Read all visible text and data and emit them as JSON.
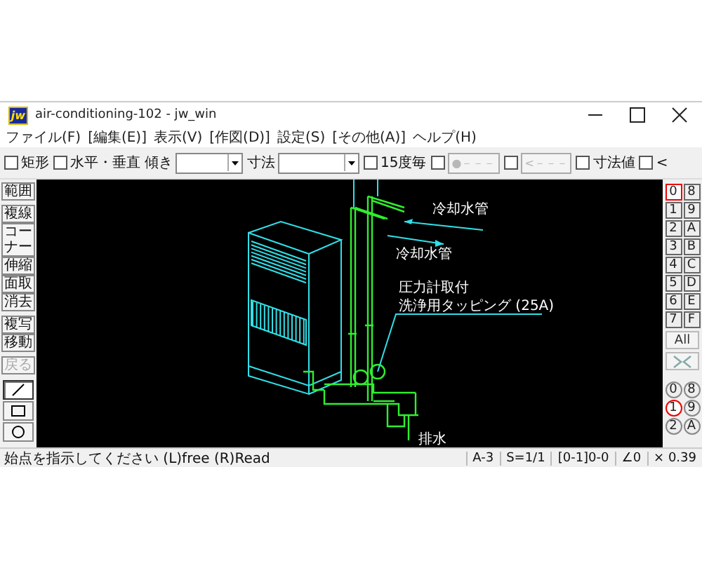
{
  "window": {
    "app_icon": "jw",
    "title": "air-conditioning-102 - jw_win"
  },
  "menu": [
    "ファイル(F)",
    "[編集(E)]",
    "表示(V)",
    "[作図(D)]",
    "設定(S)",
    "[その他(A)]",
    "ヘルプ(H)"
  ],
  "toolbar": [
    {
      "kind": "checkbox",
      "label": "矩形",
      "checked": false
    },
    {
      "kind": "checkbox",
      "label": "水平・垂直",
      "checked": false
    },
    {
      "kind": "dropdown",
      "label": "傾き"
    },
    {
      "kind": "dropdown",
      "label": "寸法"
    },
    {
      "kind": "checkbox",
      "label": "15度毎",
      "checked": false
    },
    {
      "kind": "checkbutton",
      "checked": false,
      "button": "●－－－",
      "disabled": true
    },
    {
      "kind": "checkbutton",
      "checked": false,
      "button": "<－－－",
      "disabled": true
    },
    {
      "kind": "checkbox",
      "label": "寸法値",
      "checked": false
    },
    {
      "kind": "checkbox",
      "label": "<",
      "checked": false
    }
  ],
  "tool_groups": [
    [
      {
        "label": "範囲",
        "disabled": false
      }
    ],
    [
      {
        "label": "複線",
        "disabled": false
      },
      {
        "label": "コーナー",
        "disabled": false
      },
      {
        "label": "伸縮",
        "disabled": false
      },
      {
        "label": "面取",
        "disabled": false
      },
      {
        "label": "消去",
        "disabled": false
      }
    ],
    [
      {
        "label": "複写",
        "disabled": false
      },
      {
        "label": "移動",
        "disabled": false
      }
    ],
    [
      {
        "label": "戻る",
        "disabled": true
      }
    ]
  ],
  "draw_tools": [
    {
      "kind": "line",
      "selected": true
    },
    {
      "kind": "rect",
      "selected": false
    },
    {
      "kind": "circle",
      "selected": false
    }
  ],
  "layers": [
    {
      "label": "0",
      "selected": true
    },
    {
      "label": "8",
      "selected": false
    },
    {
      "label": "1",
      "selected": false
    },
    {
      "label": "9",
      "selected": false
    },
    {
      "label": "2",
      "selected": false
    },
    {
      "label": "A",
      "selected": false
    },
    {
      "label": "3",
      "selected": false
    },
    {
      "label": "B",
      "selected": false
    },
    {
      "label": "4",
      "selected": false
    },
    {
      "label": "C",
      "selected": false
    },
    {
      "label": "5",
      "selected": false
    },
    {
      "label": "D",
      "selected": false
    },
    {
      "label": "6",
      "selected": false
    },
    {
      "label": "E",
      "selected": false
    },
    {
      "label": "7",
      "selected": false
    },
    {
      "label": "F",
      "selected": false
    }
  ],
  "layer_buttons": [
    {
      "kind": "text",
      "label": "All"
    },
    {
      "kind": "icon"
    }
  ],
  "layer_groups": [
    {
      "label": "0",
      "selected": false
    },
    {
      "label": "8",
      "selected": false
    },
    {
      "label": "1",
      "selected": true
    },
    {
      "label": "9",
      "selected": false
    },
    {
      "label": "2",
      "selected": false
    },
    {
      "label": "A",
      "selected": false
    }
  ],
  "drawing": {
    "labels": [
      "冷却水管",
      "冷却水管",
      "圧力計取付",
      "洗浄用タッピング (25A)",
      "排水"
    ]
  },
  "status_bar": {
    "message": "始点を指示してください (L)free (R)Read",
    "cells": [
      "A-3",
      "S=1/1",
      "[0-1]0-0",
      "∠0",
      "× 0.39"
    ]
  }
}
